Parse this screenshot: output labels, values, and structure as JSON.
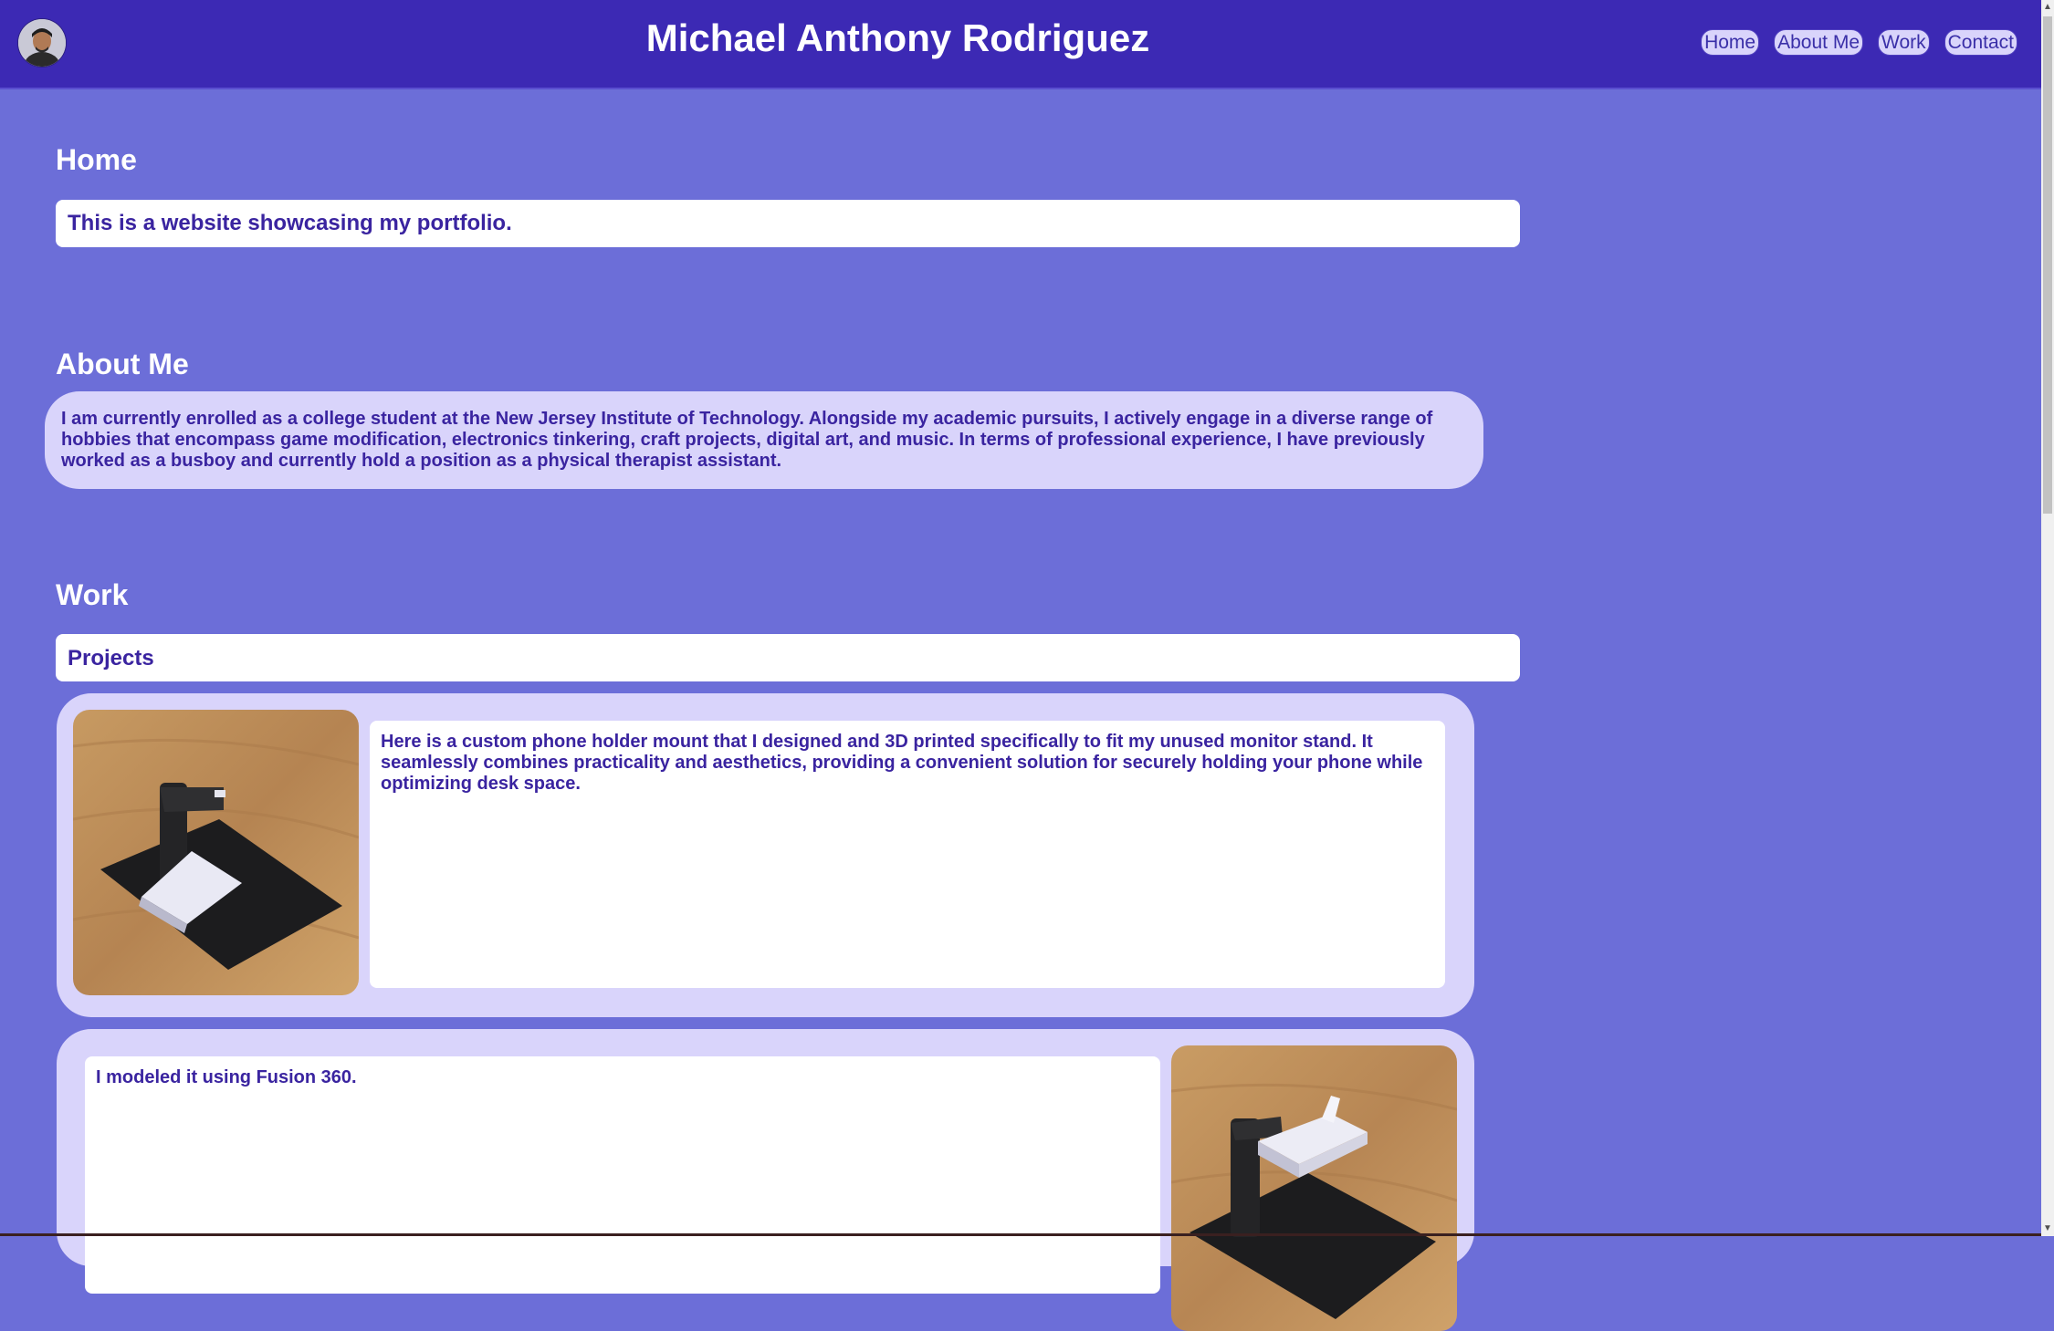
{
  "header": {
    "title": "Michael Anthony Rodriguez",
    "nav": [
      "Home",
      "About Me",
      "Work",
      "Contact"
    ]
  },
  "home": {
    "heading": "Home",
    "text": "This is a website showcasing my portfolio."
  },
  "about": {
    "heading": "About Me",
    "text": "I am currently enrolled as a college student at the New Jersey Institute of Technology. Alongside my academic pursuits, I actively engage in a diverse range of hobbies that encompass game modification, electronics tinkering, craft projects, digital art, and music. In terms of professional experience, I have previously worked as a busboy and currently hold a position as a physical therapist assistant."
  },
  "work": {
    "heading": "Work",
    "subheading": "Projects",
    "projects": [
      {
        "text": "Here is a custom phone holder mount that I designed and 3D printed specifically to fit my unused monitor stand. It seamlessly combines practicality and aesthetics, providing a convenient solution for securely holding your phone while optimizing desk space."
      },
      {
        "text": "I modeled it using Fusion 360."
      }
    ]
  },
  "colors": {
    "background": "#6c6ed8",
    "header": "#3c29b4",
    "card": "#d9d4fb",
    "text_accent": "#3a24a0"
  }
}
